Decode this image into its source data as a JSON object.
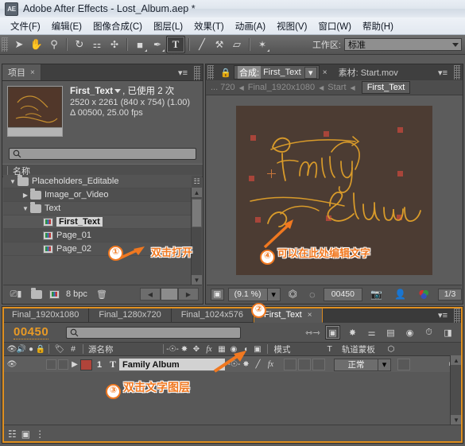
{
  "window": {
    "app_icon": "AE",
    "title": "Adobe After Effects - Lost_Album.aep *"
  },
  "menubar": {
    "items": [
      {
        "label": "文件(F)"
      },
      {
        "label": "编辑(E)"
      },
      {
        "label": "图像合成(C)"
      },
      {
        "label": "图层(L)"
      },
      {
        "label": "效果(T)"
      },
      {
        "label": "动画(A)"
      },
      {
        "label": "视图(V)"
      },
      {
        "label": "窗口(W)"
      },
      {
        "label": "帮助(H)"
      }
    ]
  },
  "toolbar": {
    "tools": [
      {
        "name": "selection-tool",
        "glyph": "➤"
      },
      {
        "name": "hand-tool",
        "glyph": "✋"
      },
      {
        "name": "zoom-tool",
        "glyph": "⚲"
      },
      {
        "name": "rotation-tool",
        "glyph": "↻"
      },
      {
        "name": "camera-tool",
        "glyph": "⚇"
      },
      {
        "name": "pan-behind-tool",
        "glyph": "✣"
      },
      {
        "name": "shape-tool",
        "glyph": "■"
      },
      {
        "name": "pen-tool",
        "glyph": "✒"
      },
      {
        "name": "text-tool",
        "glyph": "T"
      },
      {
        "name": "brush-tool",
        "glyph": "╱"
      },
      {
        "name": "clone-stamp-tool",
        "glyph": "⚒"
      },
      {
        "name": "eraser-tool",
        "glyph": "▱"
      },
      {
        "name": "puppet-pin-tool",
        "glyph": "✦"
      }
    ],
    "workspace_label": "工作区:",
    "workspace_value": "标准"
  },
  "project_panel": {
    "tab_label": "项目",
    "close_glyph": "×",
    "menu_glyph": "≡",
    "item_name": "First_Text",
    "usage_text": ", 已使用 2 次",
    "dimensions": "2520 x 2261  (840 x 754) (1.00)",
    "duration": "Δ 00500, 25.00 fps",
    "search_placeholder": "",
    "column_header": "名称",
    "tree": [
      {
        "label": "Placeholders_Editable",
        "indent": 0,
        "twist": "open",
        "icon": "folder",
        "selected": false
      },
      {
        "label": "Image_or_Video",
        "indent": 1,
        "twist": "closed",
        "icon": "folder",
        "selected": false
      },
      {
        "label": "Text",
        "indent": 1,
        "twist": "open",
        "icon": "folder",
        "selected": false
      },
      {
        "label": "First_Text",
        "indent": 2,
        "twist": "none",
        "icon": "comp",
        "selected": true
      },
      {
        "label": "Page_01",
        "indent": 2,
        "twist": "none",
        "icon": "comp",
        "selected": false
      },
      {
        "label": "Page_02",
        "indent": 2,
        "twist": "none",
        "icon": "comp",
        "selected": false
      }
    ],
    "footer": {
      "bpc_label": "8 bpc",
      "new_comp_icon": "new-composition-icon",
      "new_folder_icon": "new-folder-icon",
      "delete_icon": "delete-icon"
    }
  },
  "comp_panel": {
    "lock_icon": "lock-icon",
    "tab_prefix": "合成:",
    "tab_name": "First_Text",
    "tab_close": "×",
    "footage_tab": "素材: Start.mov",
    "menu_glyph": "≡",
    "breadcrumb": [
      "... 720",
      "Final_1920x1080",
      "Start",
      "First_Text"
    ],
    "canvas_text_line1": "Family",
    "canvas_text_line2": "Album",
    "footer": {
      "zoom_value": "(9.1 %)",
      "timecode": "00450",
      "resolution": "1/3",
      "snapshot_icon": "camera-icon",
      "transparency_icon": "person-icon",
      "channels_icon": "channels-icon"
    }
  },
  "timeline": {
    "tabs": [
      {
        "label": "Final_1920x1080",
        "active": false
      },
      {
        "label": "Final_1280x720",
        "active": false
      },
      {
        "label": "Final_1024x576",
        "active": false
      },
      {
        "label": "First_Text",
        "active": true,
        "close": "×"
      }
    ],
    "menu_glyph": "≡",
    "current_time": "00450",
    "search_placeholder": "",
    "column_headers": {
      "source_name": "源名称",
      "mode": "模式",
      "t": "T",
      "track_matte": "轨道蒙板",
      "number": "#",
      "tag": "tag-icon"
    },
    "layer": {
      "index": "1",
      "type_glyph": "T",
      "name": "Family Album",
      "mode": "正常",
      "eye_icon": "eye-icon",
      "audio_icon": "audio-icon",
      "solo_icon": "solo-icon",
      "lock_icon": "lock-icon"
    },
    "footer_icons": [
      "toggle-switches-icon",
      "render-icon",
      "graph-editor-icon"
    ]
  },
  "annotations": [
    {
      "id": 1,
      "marker": "①",
      "text": "双击打开"
    },
    {
      "id": 2,
      "marker": "②",
      "text": ""
    },
    {
      "id": 3,
      "marker": "③",
      "text": "双击文字图层"
    },
    {
      "id": 4,
      "marker": "④",
      "text": "可以在此处编辑文字"
    }
  ],
  "colors": {
    "accent_orange": "#f07820",
    "timecode_orange": "#e89a26",
    "panel_bg": "#5a5a5a",
    "canvas_bg": "#4c3c33",
    "text_gold": "#d99b2a",
    "handle_red": "#a8453a"
  }
}
